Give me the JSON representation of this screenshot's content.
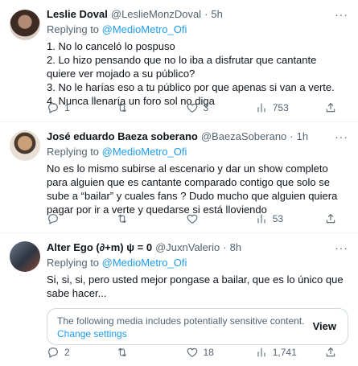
{
  "tweets": [
    {
      "name": "Leslie Doval",
      "handle": "@LeslieMonzDoval",
      "time": "5h",
      "replying_prefix": "Replying to ",
      "replying_to": "@MedioMetro_Ofi",
      "text": "1. No lo canceló lo pospuso\n2. Lo hizo pensando que no lo iba a disfrutar que cantante quiere ver mojado a su público?\n3. No le harías eso a tu público por que apenas si van a verte.\n4. Nunca llenaría un foro sol no diga",
      "replies": "1",
      "retweets": "",
      "likes": "3",
      "views": "753"
    },
    {
      "name": "José eduardo Baeza soberano",
      "handle": "@BaezaSoberano",
      "time": "1h",
      "replying_prefix": "Replying to ",
      "replying_to": "@MedioMetro_Ofi",
      "text": "No es lo mismo subirse al escenario y dar un show completo para alguien que es cantante comparado contigo que solo se sube a “bailar” y cuales fans ? Dudo mucho que alguien quiera pagar por ir a verte y quedarse si está lloviendo",
      "replies": "",
      "retweets": "",
      "likes": "",
      "views": "53"
    },
    {
      "name": "Alter Ego (∂+m) ψ = 0",
      "handle": "@JuxnValerio",
      "time": "8h",
      "replying_prefix": "Replying to ",
      "replying_to": "@MedioMetro_Ofi",
      "text": "Si, si, si, pero usted mejor pongase a bailar, que es lo único que sabe hacer...",
      "sensitive_message": "The following media includes potentially sensitive content.",
      "sensitive_link": "Change settings",
      "sensitive_view": "View",
      "replies": "2",
      "retweets": "",
      "likes": "18",
      "views": "1,741"
    }
  ],
  "more_glyph": "···",
  "separator": "·"
}
